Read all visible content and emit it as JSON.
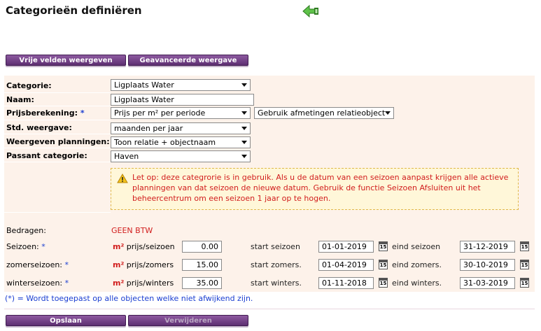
{
  "page": {
    "title": "Categorieën definiëren"
  },
  "header_buttons": {
    "free_fields": "Vrije velden weergeven",
    "advanced_view": "Geavanceerde weergave"
  },
  "form": {
    "category": {
      "label": "Categorie:",
      "value": "Ligplaats Water"
    },
    "name": {
      "label": "Naam:",
      "value": "Ligplaats Water"
    },
    "pricing": {
      "label": "Prijsberekening:",
      "required": "*",
      "value": "Prijs per m² per periode",
      "dimension_value": "Gebruik afmetingen relatieobject"
    },
    "default_view": {
      "label": "Std. weergave:",
      "value": "maanden per jaar"
    },
    "planning_view": {
      "label": "Weergeven planningen:",
      "value": "Toon relatie + objectnaam"
    },
    "passant": {
      "label": "Passant categorie:",
      "value": "Haven"
    }
  },
  "warning": {
    "icon": "warning-icon",
    "text": "Let op: deze categrorie is in gebruik. Als u de datum van een seizoen aanpast krijgen alle actieve planningen van dat seizoen de nieuwe datum. Gebruik de functie Seizoen Afsluiten uit het beheercentrum om een seizoen 1 jaar op te hogen."
  },
  "amounts": {
    "label": "Bedragen:",
    "vat": "GEEN BTW"
  },
  "seasons": [
    {
      "label": "Seizoen:",
      "required": "*",
      "unit": "m²",
      "price_label": "prijs/seizoen",
      "price": "0.00",
      "start_label": "start seizoen",
      "start": "01-01-2019",
      "end_label": "eind seizoen",
      "end": "31-12-2019"
    },
    {
      "label": "zomerseizoen:",
      "required": "*",
      "unit": "m²",
      "price_label": "prijs/zomers",
      "price": "15.00",
      "start_label": "start zomers.",
      "start": "01-04-2019",
      "end_label": "eind zomers.",
      "end": "30-10-2019"
    },
    {
      "label": "winterseizoen:",
      "required": "*",
      "unit": "m²",
      "price_label": "prijs/winters",
      "price": "35.00",
      "start_label": "start winters.",
      "start": "01-11-2018",
      "end_label": "eind winters.",
      "end": "31-03-2019"
    }
  ],
  "calendar_glyph": "15",
  "footnote": "(*) = Wordt toegepast op alle objecten welke niet afwijkend zijn.",
  "footer_buttons": {
    "save": "Opslaan",
    "delete": "Verwijderen"
  },
  "colors": {
    "accent_purple": "#6b3a80",
    "warning_red": "#d11d1d",
    "required_blue": "#1a3ed1",
    "panel_bg": "#fdf2ea"
  }
}
